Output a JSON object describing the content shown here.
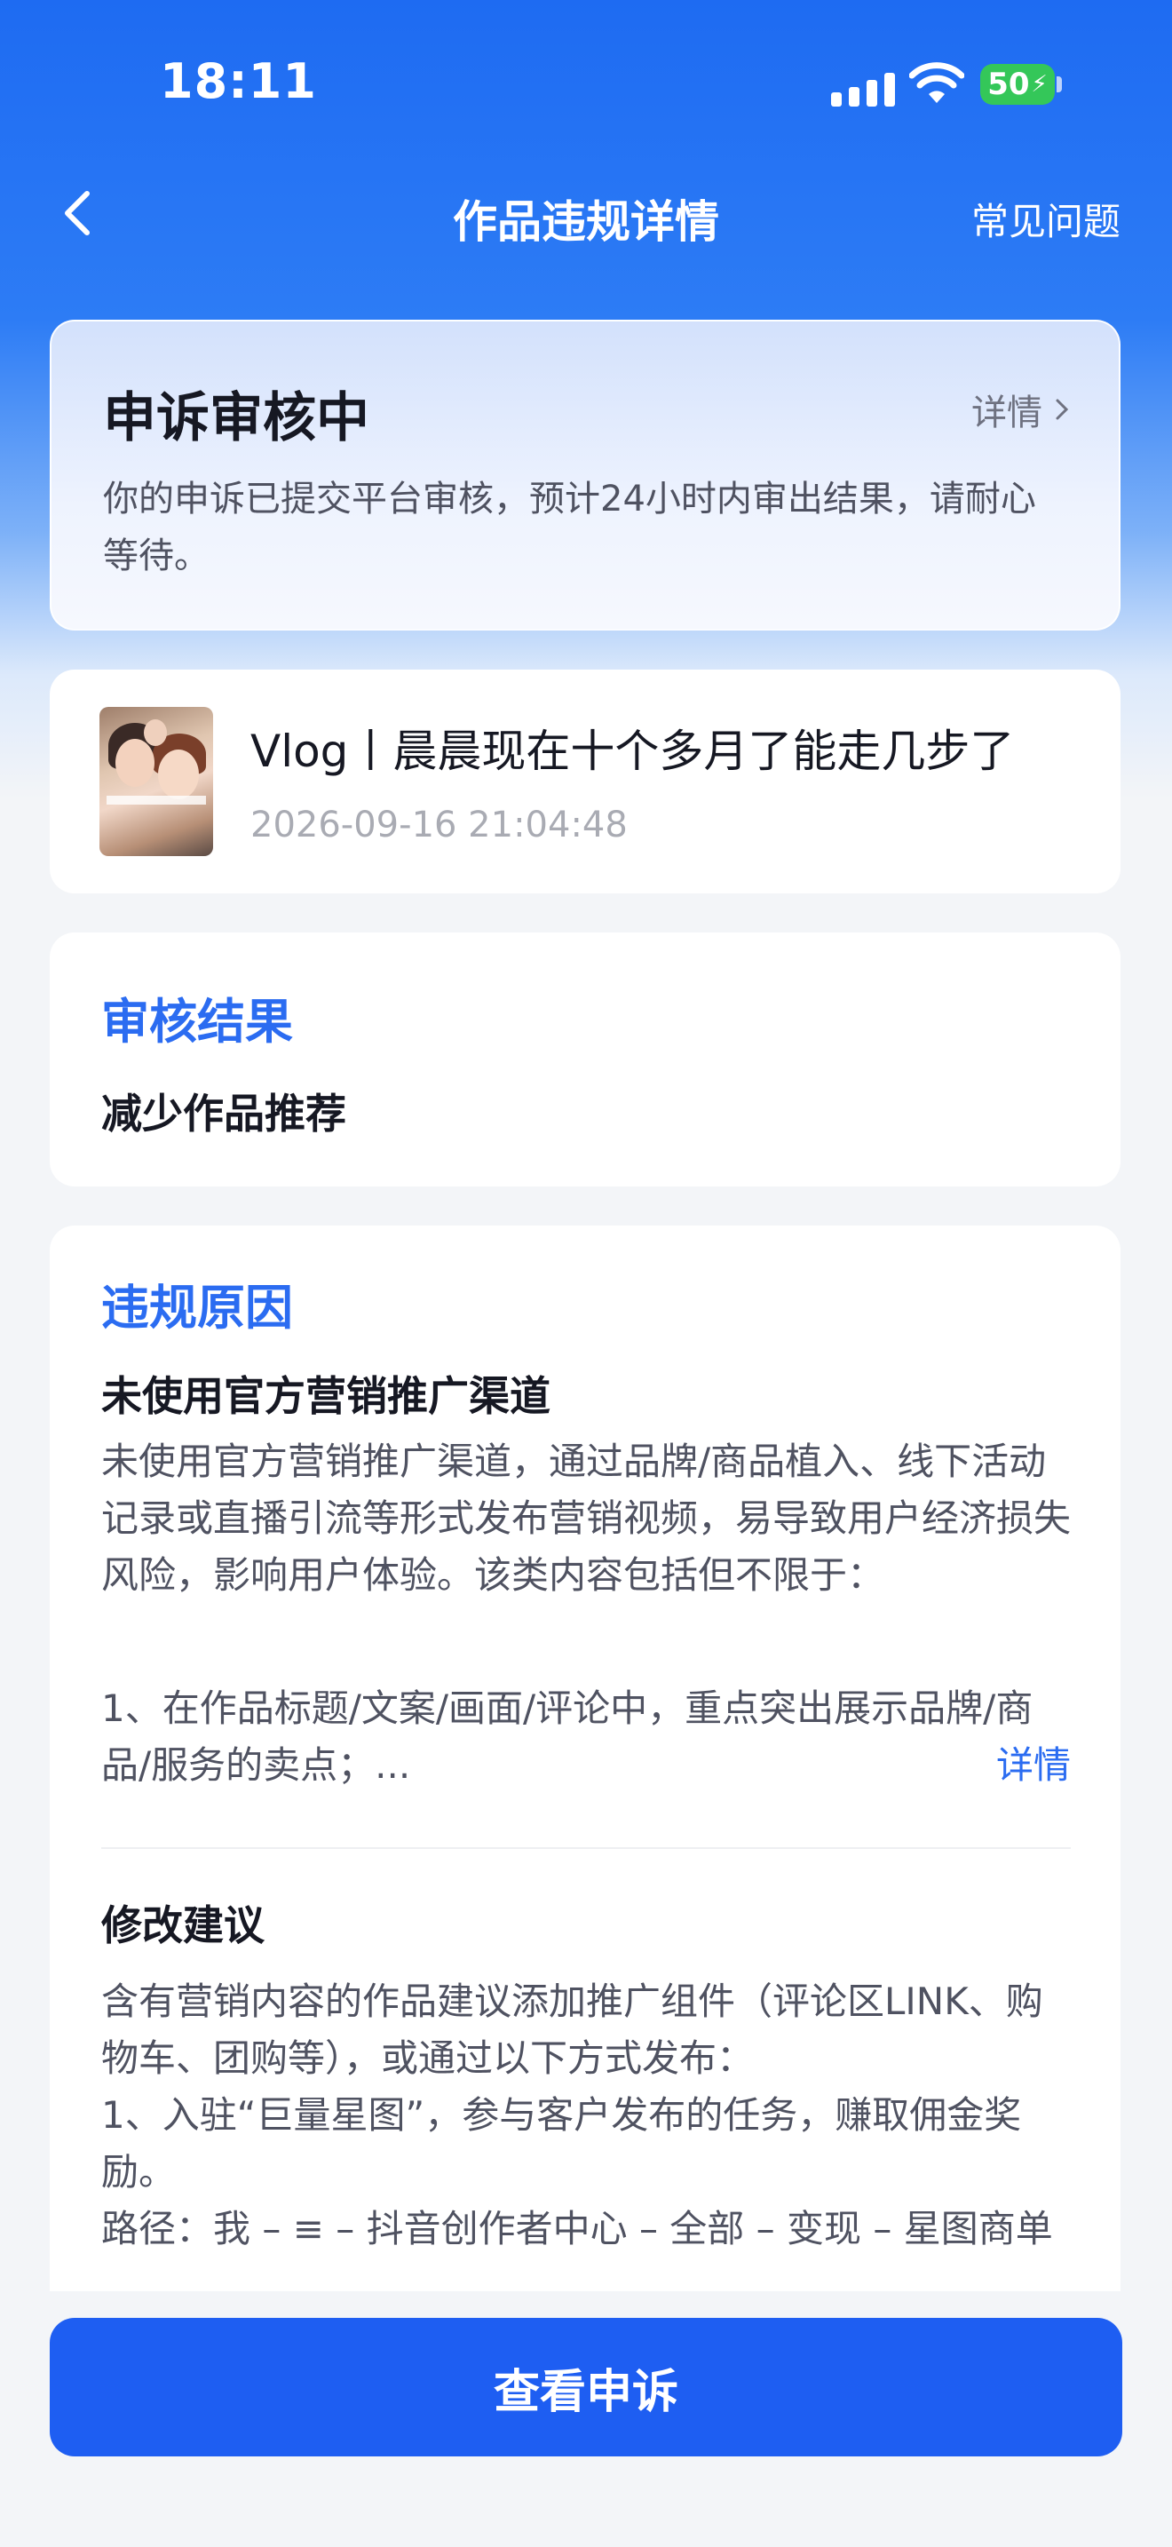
{
  "status_bar": {
    "time": "18:11",
    "battery": "50"
  },
  "nav": {
    "title": "作品违规详情",
    "faq_label": "常见问题"
  },
  "appeal": {
    "title": "申诉审核中",
    "detail_label": "详情",
    "description": "你的申诉已提交平台审核，预计24小时内审出结果，请耐心等待。"
  },
  "video": {
    "title": "Vlog丨晨晨现在十个多月了能走几步了",
    "timestamp": "2026-09-16 21:04:48"
  },
  "result": {
    "section_title": "审核结果",
    "value": "减少作品推荐"
  },
  "reason": {
    "section_title": "违规原因",
    "name": "未使用官方营销推广渠道",
    "description": "未使用官方营销推广渠道，通过品牌/商品植入、线下活动记录或直播引流等形式发布营销视频，易导致用户经济损失风险，影响用户体验。该类内容包括但不限于：",
    "item_1": "1、在作品标题/文案/画面/评论中，重点突出展示品牌/商品/服务的卖点；...",
    "more_label": "详情"
  },
  "suggestion": {
    "title": "修改建议",
    "line_1": "含有营销内容的作品建议添加推广组件（评论区LINK、购物车、团购等），或通过以下方式发布：",
    "line_2": "1、入驻“巨量星图”，参与客户发布的任务，赚取佣金奖励。",
    "line_3": "路径：我 – ≡ – 抖音创作者中心 – 全部 – 变现 – 星图商单"
  },
  "action": {
    "primary_label": "查看申诉"
  },
  "colors": {
    "brand_blue": "#1E5EF2",
    "accent_blue": "#2B6CF1",
    "battery_green": "#34C759"
  }
}
